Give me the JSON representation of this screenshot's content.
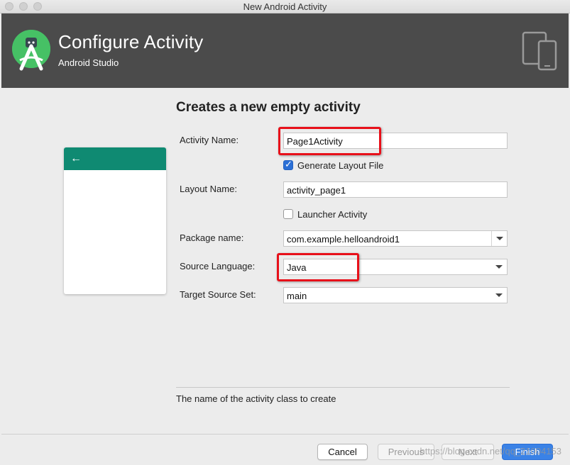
{
  "window": {
    "title": "New Android Activity"
  },
  "header": {
    "title": "Configure Activity",
    "subtitle": "Android Studio"
  },
  "main": {
    "heading": "Creates a new empty activity",
    "activity_name": {
      "label": "Activity Name:",
      "value": "Page1Activity"
    },
    "generate_layout": {
      "label": "Generate Layout File",
      "checked": true
    },
    "layout_name": {
      "label": "Layout Name:",
      "value": "activity_page1"
    },
    "launcher_activity": {
      "label": "Launcher Activity",
      "checked": false
    },
    "package_name": {
      "label": "Package name:",
      "value": "com.example.helloandroid1"
    },
    "source_language": {
      "label": "Source Language:",
      "value": "Java"
    },
    "target_source_set": {
      "label": "Target Source Set:",
      "value": "main"
    },
    "hint": "The name of the activity class to create"
  },
  "footer": {
    "cancel": "Cancel",
    "previous": "Previous",
    "next": "Next",
    "finish": "Finish",
    "watermark": "https://blog.csdn.net/qq_21004153"
  },
  "colors": {
    "accent": "#0f8a72",
    "highlight": "#e8101a",
    "primary": "#3a82e6",
    "header_bg": "#4b4b4b"
  }
}
